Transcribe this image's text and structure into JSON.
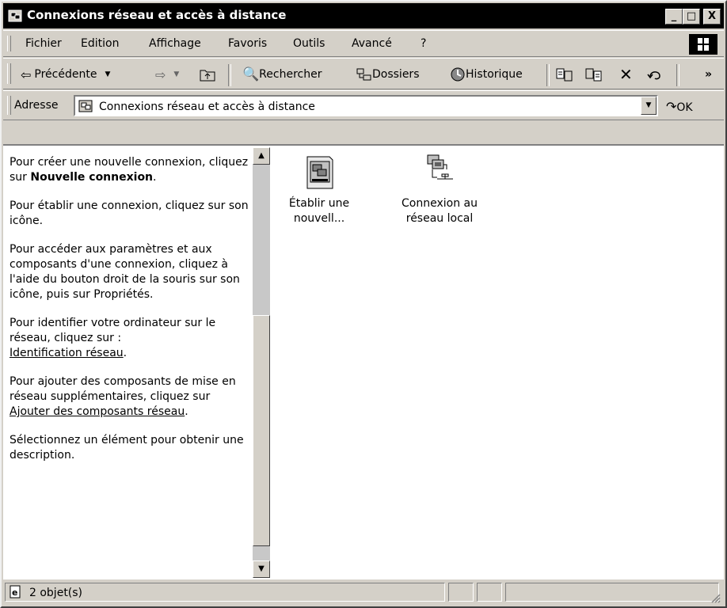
{
  "window": {
    "title": "Connexions réseau et accès à distance"
  },
  "title_buttons": {
    "minimize": "_",
    "maximize": "□",
    "close": "X"
  },
  "menu": [
    "Fichier",
    "Edition",
    "Affichage",
    "Favoris",
    "Outils",
    "Avancé",
    "?"
  ],
  "toolbar": {
    "back": "Précédente",
    "search": "Rechercher",
    "folders": "Dossiers",
    "history": "Historique",
    "more": "»"
  },
  "address": {
    "label": "Adresse",
    "value": "Connexions réseau et accès à distance",
    "go": "OK"
  },
  "info": {
    "p1_text": "Pour créer une nouvelle connexion, cliquez sur ",
    "p1_bold": "Nouvelle connexion",
    "p1_end": ".",
    "p2": "Pour établir une connexion, cliquez sur son icône.",
    "p3": "Pour accéder aux paramètres et aux composants d'une connexion, cliquez à l'aide du bouton droit de la souris sur son icône, puis sur Propriétés.",
    "p4_text": "Pour identifier votre ordinateur sur le réseau, cliquez sur :",
    "p4_link": "Identification réseau",
    "p4_end": ".",
    "p5_text": "Pour ajouter des composants de mise en réseau supplémentaires, cliquez sur ",
    "p5_link": "Ajouter des composants réseau",
    "p5_end": ".",
    "p6": "Sélectionnez un élément pour obtenir une description."
  },
  "items": [
    {
      "label_line1": "Établir une",
      "label_line2": "nouvell...",
      "icon": "new-connection-icon"
    },
    {
      "label_line1": "Connexion au",
      "label_line2": "réseau local",
      "icon": "lan-connection-icon"
    }
  ],
  "status": {
    "text": "2 objet(s)"
  }
}
